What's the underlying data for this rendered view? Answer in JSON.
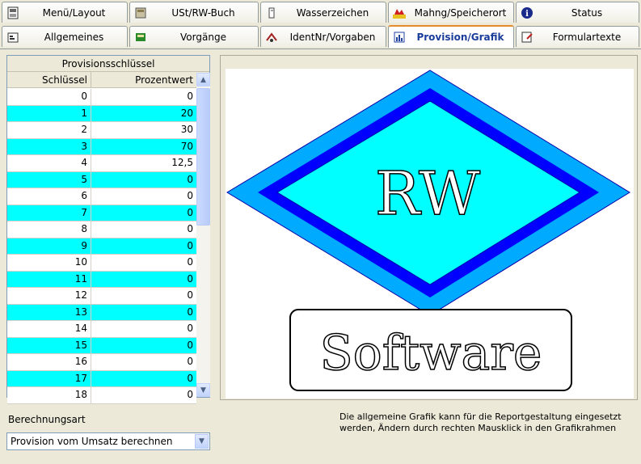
{
  "tabs": {
    "row1": [
      {
        "label": "Menü/Layout",
        "icon": "layout-icon"
      },
      {
        "label": "USt/RW-Buch",
        "icon": "book-icon"
      },
      {
        "label": "Wasserzeichen",
        "icon": "watermark-icon"
      },
      {
        "label": "Mahng/Speicherort",
        "icon": "reminder-icon"
      },
      {
        "label": "Status",
        "icon": "info-icon"
      }
    ],
    "row2": [
      {
        "label": "Allgemeines",
        "icon": "properties-icon"
      },
      {
        "label": "Vorgänge",
        "icon": "process-icon"
      },
      {
        "label": "IdentNr/Vorgaben",
        "icon": "ident-icon"
      },
      {
        "label": "Provision/Grafik",
        "icon": "chart-icon",
        "active": true
      },
      {
        "label": "Formulartexte",
        "icon": "form-icon"
      }
    ]
  },
  "table": {
    "title": "Provisionsschlüssel",
    "col_key": "Schlüssel",
    "col_value": "Prozentwert",
    "rows": [
      {
        "key": "0",
        "value": "0"
      },
      {
        "key": "1",
        "value": "20"
      },
      {
        "key": "2",
        "value": "30"
      },
      {
        "key": "3",
        "value": "70"
      },
      {
        "key": "4",
        "value": "12,5"
      },
      {
        "key": "5",
        "value": "0"
      },
      {
        "key": "6",
        "value": "0"
      },
      {
        "key": "7",
        "value": "0"
      },
      {
        "key": "8",
        "value": "0"
      },
      {
        "key": "9",
        "value": "0"
      },
      {
        "key": "10",
        "value": "0"
      },
      {
        "key": "11",
        "value": "0"
      },
      {
        "key": "12",
        "value": "0"
      },
      {
        "key": "13",
        "value": "0"
      },
      {
        "key": "14",
        "value": "0"
      },
      {
        "key": "15",
        "value": "0"
      },
      {
        "key": "16",
        "value": "0"
      },
      {
        "key": "17",
        "value": "0"
      },
      {
        "key": "18",
        "value": "0"
      }
    ]
  },
  "graphic": {
    "logo_text_top": "RW",
    "logo_text_bottom": "Software",
    "colors": {
      "diamond_outer": "#00aaff",
      "diamond_band": "#0000ff",
      "diamond_inner": "#00ffff"
    }
  },
  "calc": {
    "label": "Berechnungsart",
    "value": "Provision vom Umsatz berechnen"
  },
  "info_text": "Die allgemeine Grafik kann für die Reportgestaltung eingesetzt werden, Ändern durch rechten Mausklick in den Grafikrahmen",
  "colors": {
    "row_alt": "#00ffff",
    "active_tab_text": "#1a3c9a"
  }
}
